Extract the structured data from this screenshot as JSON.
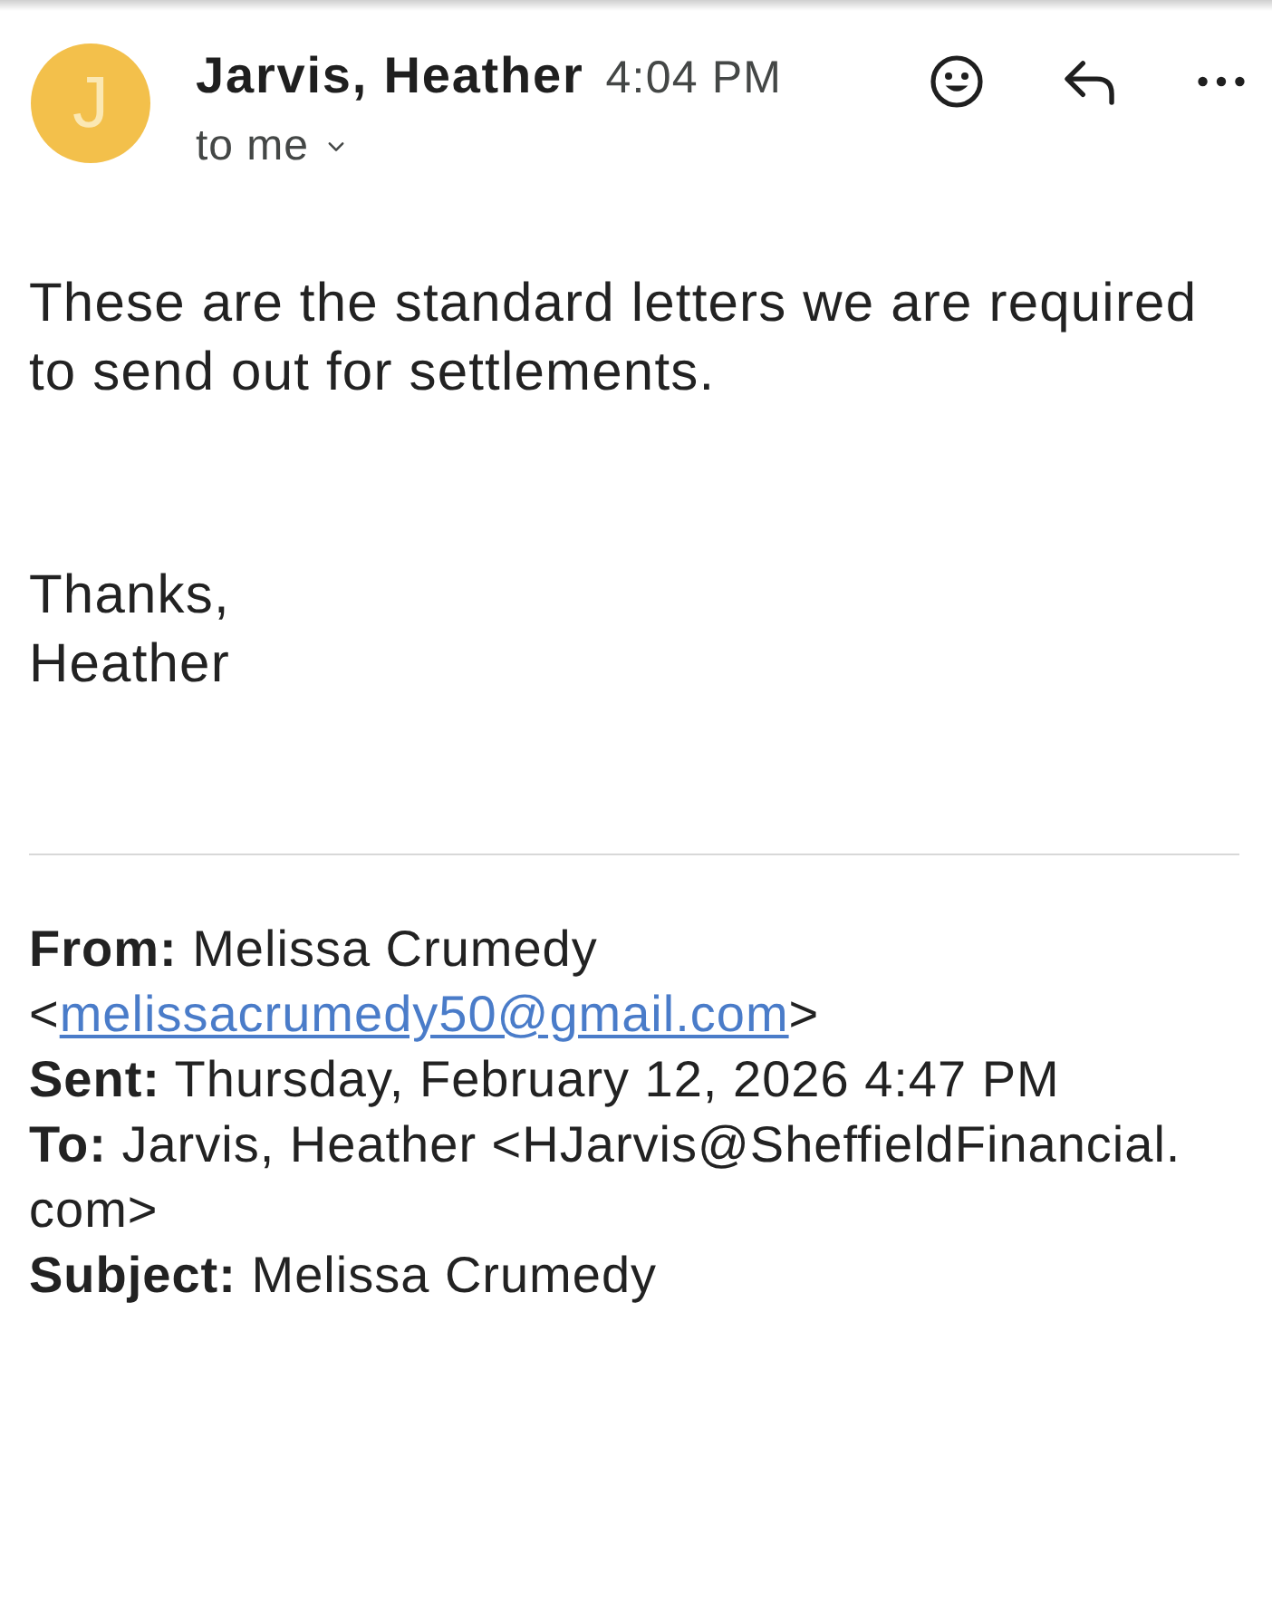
{
  "header": {
    "avatar_letter": "J",
    "sender": "Jarvis, Heather",
    "time": "4:04 PM",
    "recipient": "to me"
  },
  "body": [
    {
      "lines": [
        "These are the standard letters we are required to send out for settlements."
      ]
    },
    {
      "lines": [
        "Thanks,",
        "Heather"
      ]
    }
  ],
  "quoted_header": [
    {
      "kind": "contact",
      "text": "**From:** Melissa Crumedy <",
      "link": "melissacrumedy50@gmail.com",
      "after": ">"
    },
    {
      "kind": "text",
      "text": "**Sent:** Thursday, February 12, 2026 4:47 PM"
    },
    {
      "kind": "text",
      "text": "**To:** Jarvis, Heather <HJarvis@SheffieldFinancial.com>"
    },
    {
      "kind": "text",
      "text": "**Subject:** Melissa Crumedy"
    }
  ]
}
